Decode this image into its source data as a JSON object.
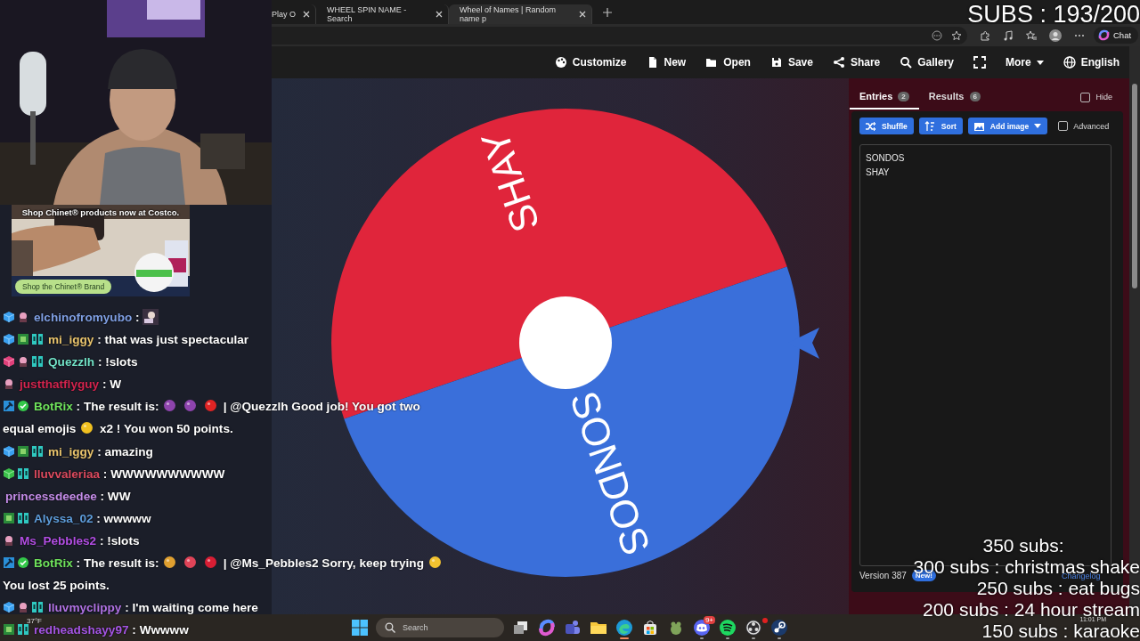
{
  "overlay": {
    "subs_counter": "SUBS : 193/200",
    "goals": [
      {
        "text": "350 subs:",
        "kind": "heading"
      },
      {
        "text": "300 subs : christmas shake",
        "kind": "goal"
      },
      {
        "text": "250 subs : eat bugs",
        "kind": "goal"
      },
      {
        "text": "200 subs : 24 hour stream",
        "kind": "goal"
      },
      {
        "text": "150 subs : karaoke",
        "kind": "goal"
      }
    ]
  },
  "ad": {
    "kind": "picture",
    "caption": "Shop Chinet® products now at Costco.",
    "button": "Shop the Chinet® Brand"
  },
  "chat": {
    "messages": [
      {
        "badges": [
          {
            "kind": "sub-blue"
          },
          {
            "kind": "mini"
          }
        ],
        "user": "elchinofromyubo",
        "color": "#7f9fe3",
        "parts": [
          {
            "kind": "text",
            "text": ":"
          },
          {
            "kind": "emote"
          }
        ]
      },
      {
        "badges": [
          {
            "kind": "sub-blue"
          },
          {
            "kind": "art"
          },
          {
            "kind": "gg"
          }
        ],
        "user": "mi_iggy",
        "color": "#e8c36c",
        "parts": [
          {
            "kind": "text",
            "text": ": that was just spectacular"
          }
        ]
      },
      {
        "badges": [
          {
            "kind": "sub-pink"
          },
          {
            "kind": "mini"
          },
          {
            "kind": "gg"
          }
        ],
        "user": "Quezzlh",
        "color": "#72e3c8",
        "parts": [
          {
            "kind": "text",
            "text": ": !slots"
          }
        ]
      },
      {
        "badges": [
          {
            "kind": "mini"
          }
        ],
        "user": "justthatflyguy",
        "color": "#d3244e",
        "parts": [
          {
            "kind": "text",
            "text": ": W"
          }
        ]
      },
      {
        "badges": [
          {
            "kind": "bot"
          },
          {
            "kind": "verified"
          }
        ],
        "user": "BotRix",
        "color": "#6fe35c",
        "parts": [
          {
            "kind": "text",
            "text": ": The result is:"
          },
          {
            "kind": "emoji",
            "color": "#8e44ad"
          },
          {
            "kind": "emoji",
            "color": "#8e44ad"
          },
          {
            "kind": "emoji",
            "color": "#e02424"
          },
          {
            "kind": "text",
            "text": "| @Quezzlh Good job! You got two"
          },
          {
            "kind": "text",
            "text": "equal emojis"
          },
          {
            "kind": "emoji",
            "color": "#f0c020"
          },
          {
            "kind": "text",
            "text": "x2 ! You won 50 points."
          }
        ]
      },
      {
        "badges": [
          {
            "kind": "sub-blue"
          },
          {
            "kind": "art"
          },
          {
            "kind": "gg"
          }
        ],
        "user": "mi_iggy",
        "color": "#e8c36c",
        "parts": [
          {
            "kind": "text",
            "text": ": amazing"
          }
        ]
      },
      {
        "badges": [
          {
            "kind": "sub-green"
          },
          {
            "kind": "gg"
          }
        ],
        "user": "lluvvaleriaa",
        "color": "#dc4a5e",
        "parts": [
          {
            "kind": "text",
            "text": ": WWWWWWWWWW"
          }
        ]
      },
      {
        "user": "princessdeedee",
        "color": "#c48ce8",
        "parts": [
          {
            "kind": "text",
            "text": ": WW"
          }
        ]
      },
      {
        "badges": [
          {
            "kind": "art"
          },
          {
            "kind": "gg"
          }
        ],
        "user": "Alyssa_02",
        "color": "#5e9ddb",
        "parts": [
          {
            "kind": "text",
            "text": ": wwwww"
          }
        ]
      },
      {
        "badges": [
          {
            "kind": "mini"
          }
        ],
        "user": "Ms_Pebbles2",
        "color": "#b24ee3",
        "parts": [
          {
            "kind": "text",
            "text": ": !slots"
          }
        ]
      },
      {
        "badges": [
          {
            "kind": "bot"
          },
          {
            "kind": "verified"
          }
        ],
        "user": "BotRix",
        "color": "#6fe35c",
        "parts": [
          {
            "kind": "text",
            "text": ": The result is:"
          },
          {
            "kind": "emoji",
            "color": "#e0a030"
          },
          {
            "kind": "emoji",
            "color": "#e04458"
          },
          {
            "kind": "emoji",
            "color": "#d81e34"
          },
          {
            "kind": "text",
            "text": "| @Ms_Pebbles2 Sorry, keep trying"
          },
          {
            "kind": "emoji",
            "color": "#f2c230"
          },
          {
            "kind": "text",
            "text": "You lost 25 points."
          }
        ]
      },
      {
        "badges": [
          {
            "kind": "sub-blue"
          },
          {
            "kind": "mini"
          },
          {
            "kind": "gg"
          }
        ],
        "user": "lluvmyclippy",
        "color": "#b072e3",
        "parts": [
          {
            "kind": "text",
            "text": ": I'm waiting come here"
          }
        ]
      },
      {
        "badges": [
          {
            "kind": "art"
          },
          {
            "kind": "gg"
          }
        ],
        "user": "redheadshayy97",
        "color": "#a455e3",
        "parts": [
          {
            "kind": "text",
            "text": ": Wwwww"
          }
        ]
      }
    ]
  },
  "browser": {
    "tabs": [
      {
        "title": "Play O",
        "selected": false
      },
      {
        "title": "WHEEL SPIN NAME - Search",
        "selected": false
      },
      {
        "title": "Wheel of Names | Random name p",
        "selected": true
      }
    ],
    "chat_button": "Chat"
  },
  "app": {
    "nav": [
      {
        "kind": "button",
        "label": "Customize"
      },
      {
        "kind": "button",
        "label": "New"
      },
      {
        "kind": "button",
        "label": "Open"
      },
      {
        "kind": "button",
        "label": "Save"
      },
      {
        "kind": "button",
        "label": "Share"
      },
      {
        "kind": "button",
        "label": "Gallery"
      },
      {
        "kind": "icon"
      },
      {
        "kind": "dropdown",
        "label": "More"
      },
      {
        "kind": "button",
        "label": "English"
      }
    ],
    "wheel": {
      "slices": [
        {
          "label": "SHAY",
          "color": "#e0253b"
        },
        {
          "label": "SONDOS",
          "color": "#3a6fda"
        }
      ]
    },
    "panel": {
      "tabs": [
        {
          "label": "Entries",
          "count": "2",
          "selected": true
        },
        {
          "label": "Results",
          "count": "6",
          "selected": false
        }
      ],
      "hide": {
        "label": "Hide",
        "checked": false
      },
      "tools": [
        {
          "kind": "button",
          "label": "Shuffle"
        },
        {
          "kind": "button",
          "label": "Sort"
        },
        {
          "kind": "dropdown",
          "label": "Add image"
        }
      ],
      "advanced": {
        "label": "Advanced",
        "checked": false
      },
      "entries": [
        "SONDOS",
        "SHAY"
      ],
      "version": "Version 387",
      "badge": "New!",
      "changelog": "Changelog"
    }
  },
  "taskbar": {
    "weather": "37°F",
    "search": "Search",
    "clock": "11:01 PM",
    "apps": [
      {
        "selected": false,
        "running": false
      },
      {
        "selected": false,
        "running": false
      },
      {
        "selected": false,
        "running": false
      },
      {
        "selected": false,
        "running": false
      },
      {
        "selected": true,
        "running": true
      },
      {
        "selected": false,
        "running": false
      },
      {
        "selected": false,
        "running": false
      },
      {
        "selected": false,
        "running": true,
        "badge": "9+"
      },
      {
        "selected": false,
        "running": true
      },
      {
        "selected": false,
        "running": true,
        "alert": true
      },
      {
        "selected": false,
        "running": true
      }
    ]
  }
}
